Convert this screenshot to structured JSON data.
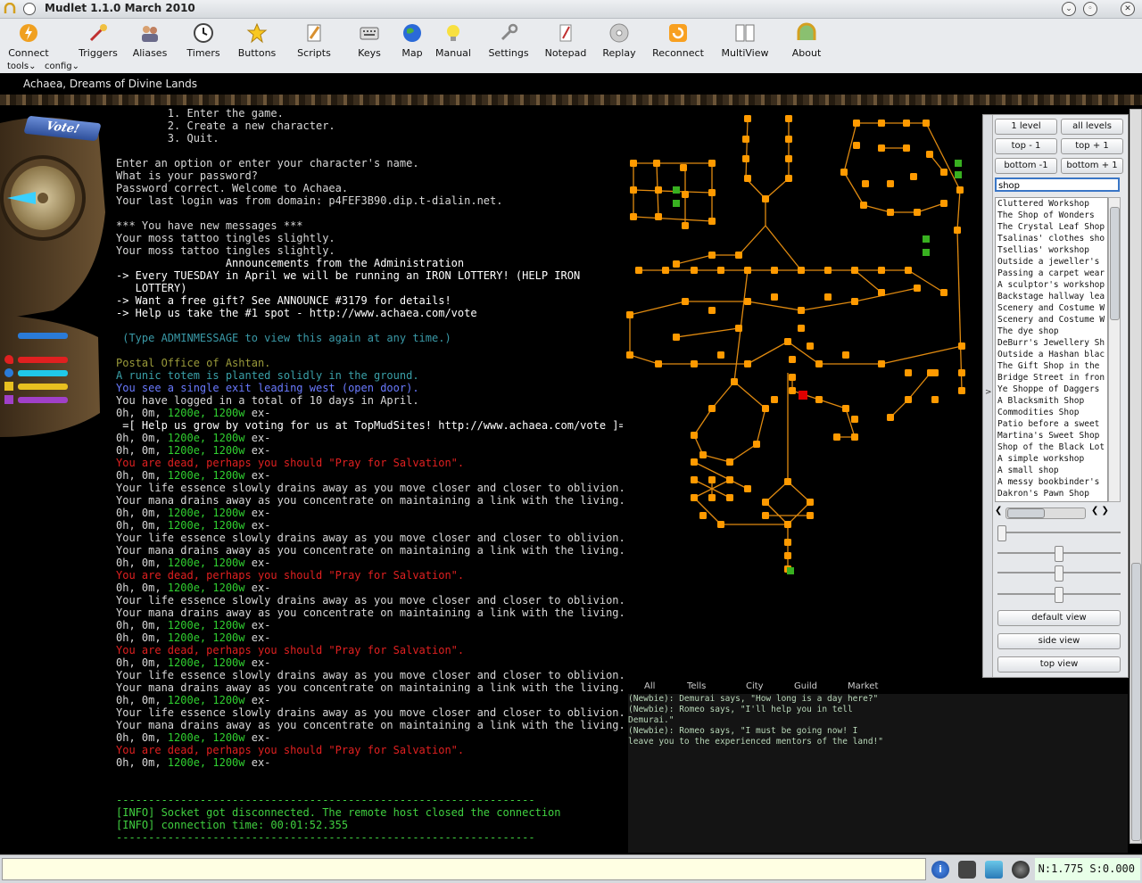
{
  "window": {
    "title": "Mudlet 1.1.0 March 2010"
  },
  "toolbar": {
    "buttons": [
      {
        "label": "Connect",
        "icon": "lightning-icon"
      },
      {
        "label": "Triggers",
        "icon": "triggers-icon"
      },
      {
        "label": "Aliases",
        "icon": "people-icon"
      },
      {
        "label": "Timers",
        "icon": "clock-icon"
      },
      {
        "label": "Buttons",
        "icon": "star-icon"
      },
      {
        "label": "Scripts",
        "icon": "pencil-icon"
      },
      {
        "label": "Keys",
        "icon": "keyboard-icon"
      },
      {
        "label": "Map",
        "icon": "globe-icon"
      },
      {
        "label": "Manual",
        "icon": "bulb-icon"
      },
      {
        "label": "Settings",
        "icon": "wrench-icon"
      },
      {
        "label": "Notepad",
        "icon": "notepad-icon"
      },
      {
        "label": "Replay",
        "icon": "disc-icon"
      },
      {
        "label": "Reconnect",
        "icon": "reconnect-icon"
      },
      {
        "label": "MultiView",
        "icon": "windows-icon"
      },
      {
        "label": "About",
        "icon": "about-icon"
      }
    ],
    "menus": [
      "tools",
      "config"
    ]
  },
  "banner": {
    "title": "Achaea, Dreams of Divine Lands"
  },
  "left_panel": {
    "vote_label": "Vote!"
  },
  "console": {
    "lines": [
      {
        "t": "        1. Enter the game.",
        "c": "#d8d8d8"
      },
      {
        "t": "        2. Create a new character.",
        "c": "#d8d8d8"
      },
      {
        "t": "        3. Quit.",
        "c": "#d8d8d8"
      },
      {
        "t": "",
        "c": "#d8d8d8"
      },
      {
        "t": "Enter an option or enter your character's name.",
        "c": "#d8d8d8"
      },
      {
        "t": "What is your password?",
        "c": "#d8d8d8"
      },
      {
        "t": "Password correct. Welcome to Achaea.",
        "c": "#d8d8d8"
      },
      {
        "t": "Your last login was from domain: p4FEF3B90.dip.t-dialin.net.",
        "c": "#d8d8d8"
      },
      {
        "t": "",
        "c": "#d8d8d8"
      },
      {
        "t": "*** You have new messages ***",
        "c": "#d8d8d8"
      },
      {
        "t": "Your moss tattoo tingles slightly.",
        "c": "#d8d8d8"
      },
      {
        "t": "Your moss tattoo tingles slightly.",
        "c": "#d8d8d8"
      },
      {
        "t": "                 Announcements from the Administration",
        "c": "#ffffff"
      },
      {
        "t": "-> Every TUESDAY in April we will be running an IRON LOTTERY! (HELP IRON",
        "c": "#ffffff"
      },
      {
        "t": "   LOTTERY)",
        "c": "#ffffff"
      },
      {
        "t": "-> Want a free gift? See ANNOUNCE #3179 for details!",
        "c": "#ffffff"
      },
      {
        "t": "-> Help us take the #1 spot - http://www.achaea.com/vote",
        "c": "#ffffff"
      },
      {
        "t": "",
        "c": "#d8d8d8"
      },
      {
        "t": " (Type ADMINMESSAGE to view this again at any time.)",
        "c": "#3a9aa8"
      },
      {
        "t": "",
        "c": "#d8d8d8"
      },
      {
        "t": "Postal Office of Ashtan.",
        "c": "#9a9a3a"
      },
      {
        "t": "A runic totem is planted solidly in the ground.",
        "c": "#3aa0a8"
      },
      {
        "t": "You see a single exit leading west (open door).",
        "c": "#6a7aff"
      },
      {
        "t": "You have logged in a total of 10 days in April.",
        "c": "#d8d8d8"
      },
      {
        "t": "0h, 0m, 1200e, 1200w ex-",
        "c": "#d8d8d8",
        "green": true
      },
      {
        "t": " =[ Help us grow by voting for us at TopMudSites! http://www.achaea.com/vote ]=",
        "c": "#ffffff"
      },
      {
        "t": "0h, 0m, 1200e, 1200w ex-",
        "c": "#d8d8d8",
        "green": true
      },
      {
        "t": "0h, 0m, 1200e, 1200w ex-",
        "c": "#d8d8d8",
        "green": true
      },
      {
        "t": "You are dead, perhaps you should \"Pray for Salvation\".",
        "c": "#e02020"
      },
      {
        "t": "0h, 0m, 1200e, 1200w ex-",
        "c": "#d8d8d8",
        "green": true
      },
      {
        "t": "Your life essence slowly drains away as you move closer and closer to oblivion.",
        "c": "#d8d8d8"
      },
      {
        "t": "Your mana drains away as you concentrate on maintaining a link with the living.",
        "c": "#d8d8d8"
      },
      {
        "t": "0h, 0m, 1200e, 1200w ex-",
        "c": "#d8d8d8",
        "green": true
      },
      {
        "t": "0h, 0m, 1200e, 1200w ex-",
        "c": "#d8d8d8",
        "green": true
      },
      {
        "t": "Your life essence slowly drains away as you move closer and closer to oblivion.",
        "c": "#d8d8d8"
      },
      {
        "t": "Your mana drains away as you concentrate on maintaining a link with the living.",
        "c": "#d8d8d8"
      },
      {
        "t": "0h, 0m, 1200e, 1200w ex-",
        "c": "#d8d8d8",
        "green": true
      },
      {
        "t": "You are dead, perhaps you should \"Pray for Salvation\".",
        "c": "#e02020"
      },
      {
        "t": "0h, 0m, 1200e, 1200w ex-",
        "c": "#d8d8d8",
        "green": true
      },
      {
        "t": "Your life essence slowly drains away as you move closer and closer to oblivion.",
        "c": "#d8d8d8"
      },
      {
        "t": "Your mana drains away as you concentrate on maintaining a link with the living.",
        "c": "#d8d8d8"
      },
      {
        "t": "0h, 0m, 1200e, 1200w ex-",
        "c": "#d8d8d8",
        "green": true
      },
      {
        "t": "0h, 0m, 1200e, 1200w ex-",
        "c": "#d8d8d8",
        "green": true
      },
      {
        "t": "You are dead, perhaps you should \"Pray for Salvation\".",
        "c": "#e02020"
      },
      {
        "t": "0h, 0m, 1200e, 1200w ex-",
        "c": "#d8d8d8",
        "green": true
      },
      {
        "t": "Your life essence slowly drains away as you move closer and closer to oblivion.",
        "c": "#d8d8d8"
      },
      {
        "t": "Your mana drains away as you concentrate on maintaining a link with the living.",
        "c": "#d8d8d8"
      },
      {
        "t": "0h, 0m, 1200e, 1200w ex-",
        "c": "#d8d8d8",
        "green": true
      },
      {
        "t": "Your life essence slowly drains away as you move closer and closer to oblivion.",
        "c": "#d8d8d8"
      },
      {
        "t": "Your mana drains away as you concentrate on maintaining a link with the living.",
        "c": "#d8d8d8"
      },
      {
        "t": "0h, 0m, 1200e, 1200w ex-",
        "c": "#d8d8d8",
        "green": true
      },
      {
        "t": "You are dead, perhaps you should \"Pray for Salvation\".",
        "c": "#e02020"
      },
      {
        "t": "0h, 0m, 1200e, 1200w ex-",
        "c": "#d8d8d8",
        "green": true
      },
      {
        "t": "",
        "c": "#d8d8d8"
      },
      {
        "t": "",
        "c": "#d8d8d8"
      },
      {
        "t": "-----------------------------------------------------------------",
        "c": "#40d040"
      },
      {
        "t": "[INFO] Socket got disconnected. The remote host closed the connection",
        "c": "#40d040"
      },
      {
        "t": "[INFO] connection time: 00:01:52.355",
        "c": "#40d040"
      },
      {
        "t": "-----------------------------------------------------------------",
        "c": "#40d040"
      }
    ]
  },
  "map_controls": {
    "buttons": {
      "one_level": "1 level",
      "all_levels": "all levels",
      "top_minus": "top - 1",
      "top_plus": "top + 1",
      "bottom_minus": "bottom -1",
      "bottom_plus": "bottom + 1",
      "default_view": "default view",
      "side_view": "side view",
      "top_view": "top view"
    },
    "search_value": "shop",
    "results": [
      "Cluttered Workshop",
      "The Shop of Wonders",
      "The Crystal Leaf Shop",
      "Tsalinas' clothes sho",
      "Tsellias' workshop",
      "Outside a jeweller's",
      "Passing a carpet wear",
      "A sculptor's workshop",
      "Backstage hallway lea",
      "Scenery and Costume W",
      "Scenery and Costume W",
      "The dye shop",
      "DeBurr's Jewellery Sh",
      "Outside a Hashan blac",
      "The Gift Shop in the",
      "Bridge Street in fron",
      "Ye Shoppe of Daggers",
      "A Blacksmith Shop",
      "Commodities Shop",
      "Patio before a sweet",
      "Martina's Sweet Shop",
      "Shop of the Black Lot",
      "A simple workshop",
      "A small shop",
      "A messy bookbinder's",
      "Dakron's Pawn Shop"
    ]
  },
  "chat": {
    "tabs": [
      "All",
      "Tells",
      "City",
      "Guild",
      "Market"
    ],
    "lines": [
      "(Newbie): Demurai says, \"How long is a day here?\"",
      "(Newbie): Romeo says, \"I'll help you in tell",
      "Demurai.\"",
      "(Newbie): Romeo says, \"I must be going now! I",
      "leave you to the experienced mentors of the land!\""
    ]
  },
  "status_bar": {
    "stats": "N:1.775 S:0.000"
  },
  "colors": {
    "room": "#ff9a00",
    "exit": "#e08a10",
    "player": "#e00000",
    "green_room": "#38b020"
  }
}
